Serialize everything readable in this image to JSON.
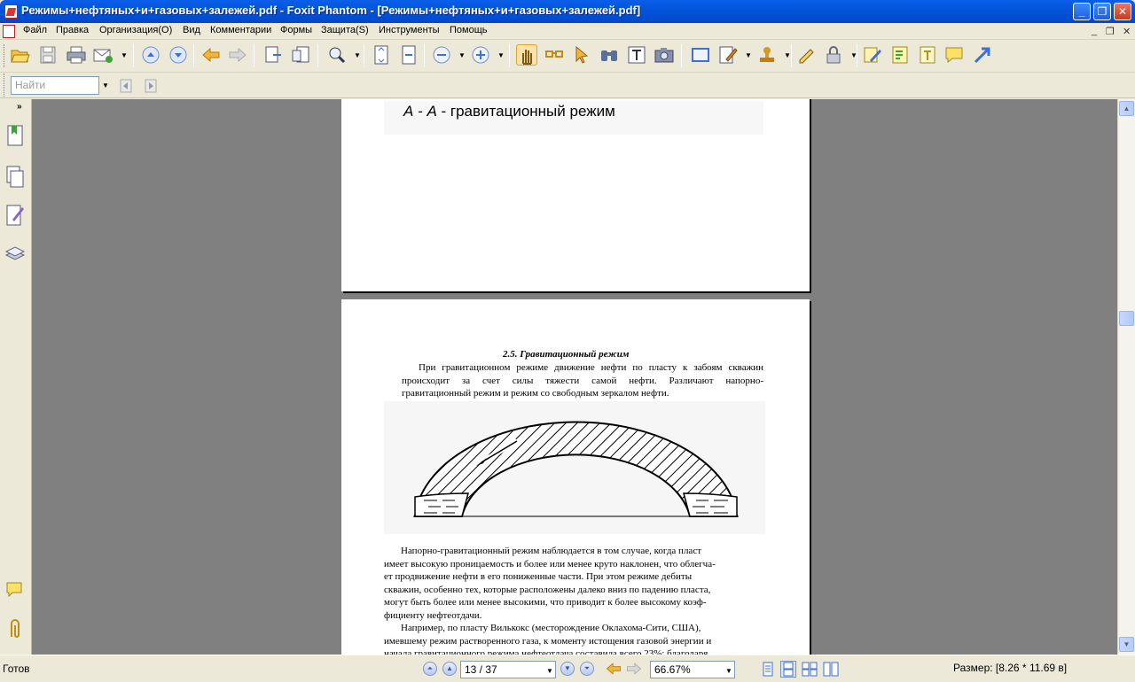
{
  "window": {
    "title": "Режимы+нефтяных+и+газовых+залежей.pdf - Foxit Phantom - [Режимы+нефтяных+и+газовых+залежей.pdf]",
    "minimize": "_",
    "restore": "❐",
    "close": "✕"
  },
  "menu": {
    "items": [
      "Файл",
      "Правка",
      "Организация(О)",
      "Вид",
      "Комментарии",
      "Формы",
      "Защита(S)",
      "Инструменты",
      "Помощь"
    ],
    "mdi_minimize": "_",
    "mdi_restore": "❐",
    "mdi_close": "✕"
  },
  "find": {
    "placeholder": "Найти"
  },
  "toolbar_icons": [
    "open-folder-icon",
    "save-icon",
    "print-icon",
    "email-icon",
    "page-up-icon",
    "page-down-icon",
    "back-icon",
    "forward-icon",
    "extract-page-icon",
    "insert-page-icon",
    "zoom-icon",
    "fit-page-icon",
    "fit-width-icon",
    "zoom-out-icon",
    "zoom-in-icon",
    "hand-tool-icon",
    "snapshot-glasses-icon",
    "select-arrow-icon",
    "find-binoculars-icon",
    "text-select-icon",
    "camera-icon",
    "rectangle-icon",
    "edit-icon",
    "stamp-icon",
    "sign-icon",
    "lock-icon",
    "note-pencil-icon",
    "form-edit-icon",
    "text-box-icon",
    "comment-icon",
    "arrow-tool-icon"
  ],
  "page1": {
    "caption_prefix": "А - А",
    "caption_text": " - гравитационный режим"
  },
  "page2": {
    "heading": "2.5. Гравитационный режим",
    "para1": [
      "При гравитационном режиме движение нефти по пласту к забоям скважин",
      "происходит за счет силы тяжести самой нефти. Различают напорно-",
      "гравитационный режим и режим со свободным зеркалом нефти."
    ],
    "para2": [
      "Напорно-гравитационный режим наблюдается в том случае, когда пласт",
      "имеет высокую проницаемость и более или менее круто наклонен, что облегча-",
      "ет продвижение нефти в его пониженные части. При этом режиме дебиты",
      "скважин, особенно тех, которые расположены далеко вниз по падению пласта,",
      "могут быть более или менее высокими, что приводит к более высокому коэф-",
      "фициенту нефтеотдачи."
    ],
    "para3": [
      "Например, по пласту Вилькокс (месторождение Оклахома-Сити, США),",
      "имевшему режим растворенного газа, к моменту истощения газовой энергии и",
      "начала гравитационного режима нефтеотдача составила всего 23%; благодаря"
    ]
  },
  "status": {
    "ready": "Готов",
    "page_value": "13 / 37",
    "zoom_value": "66.67%",
    "size": "Размер: [8.26 * 11.69 в]"
  },
  "colors": {
    "title_bar": "#0253D9",
    "viewport": "#808080",
    "chrome": "#ECE9D8"
  }
}
